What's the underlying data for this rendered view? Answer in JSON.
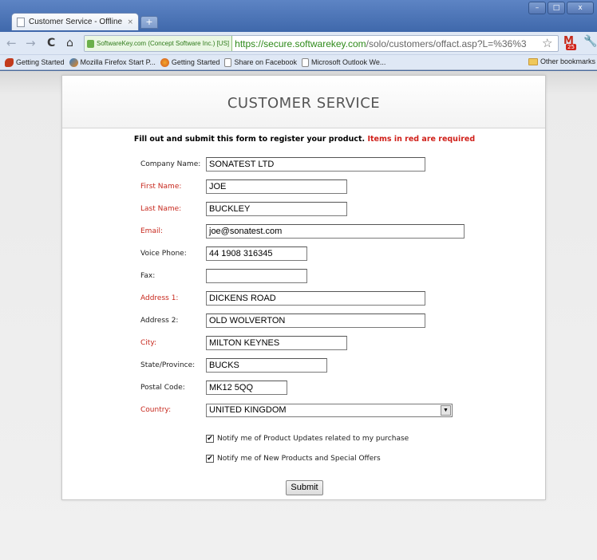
{
  "browser": {
    "tab_title": "Customer Service - Offline ...",
    "tab_close": "×",
    "new_tab": "+",
    "win_minimize": "–",
    "win_maximize": "□",
    "win_close": "x",
    "ev_label": "SoftwareKey.com (Concept Software Inc.) [US]",
    "url_host": "https://secure.softwarekey.com",
    "url_path": "/solo/customers/offact.asp?L=%36%3",
    "gmail_badge": "25",
    "bookmarks": [
      {
        "label": "Getting Started",
        "icon": "red"
      },
      {
        "label": "Mozilla Firefox Start P...",
        "icon": "ff"
      },
      {
        "label": "Getting Started",
        "icon": "ff2"
      },
      {
        "label": "Share on Facebook",
        "icon": "doc"
      },
      {
        "label": "Microsoft Outlook We...",
        "icon": "doc"
      }
    ],
    "other_bookmarks": "Other bookmarks"
  },
  "page": {
    "title": "CUSTOMER SERVICE",
    "intro": "Fill out and submit this form to register your product.",
    "intro_required": "Items in red are required",
    "fields": {
      "company": {
        "label": "Company Name:",
        "value": "SONATEST LTD"
      },
      "first_name": {
        "label": "First Name:",
        "value": "JOE"
      },
      "last_name": {
        "label": "Last Name:",
        "value": "BUCKLEY"
      },
      "email": {
        "label": "Email:",
        "value": "joe@sonatest.com"
      },
      "phone": {
        "label": "Voice Phone:",
        "value": "44 1908 316345"
      },
      "fax": {
        "label": "Fax:",
        "value": ""
      },
      "address1": {
        "label": "Address 1:",
        "value": "DICKENS ROAD"
      },
      "address2": {
        "label": "Address 2:",
        "value": "OLD WOLVERTON"
      },
      "city": {
        "label": "City:",
        "value": "MILTON KEYNES"
      },
      "state": {
        "label": "State/Province:",
        "value": "BUCKS"
      },
      "postal": {
        "label": "Postal Code:",
        "value": "MK12 5QQ"
      },
      "country": {
        "label": "Country:",
        "value": "UNITED KINGDOM"
      }
    },
    "checkboxes": {
      "updates": {
        "label": "Notify me of Product Updates related to my purchase",
        "checked": true
      },
      "offers": {
        "label": "Notify me of New Products and Special Offers",
        "checked": true
      }
    },
    "submit_label": "Submit"
  },
  "colors": {
    "required": "#c7281d",
    "url_green": "#2e8a1a"
  }
}
